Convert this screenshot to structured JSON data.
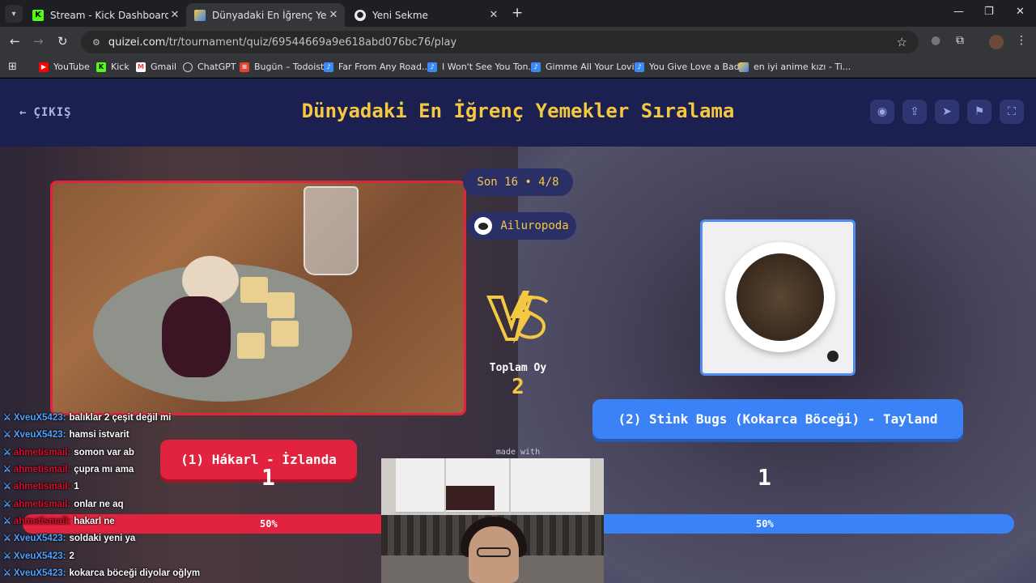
{
  "browser": {
    "tabs": [
      {
        "title": "Stream - Kick Dashboard",
        "favicon": "kick-icon",
        "active": false
      },
      {
        "title": "Dünyadaki En İğrenç Yemekler S",
        "favicon": "quizei-icon",
        "active": true
      },
      {
        "title": "Yeni Sekme",
        "favicon": "chrome-icon",
        "active": false
      }
    ],
    "url_host": "quizei.com",
    "url_path": "/tr/tournament/quiz/69544669a9e618abd076bc76/play",
    "bookmarks": [
      {
        "label": "YouTube",
        "icon": "youtube-icon"
      },
      {
        "label": "Kick",
        "icon": "kick-icon"
      },
      {
        "label": "Gmail",
        "icon": "gmail-icon"
      },
      {
        "label": "ChatGPT",
        "icon": "chatgpt-icon"
      },
      {
        "label": "Bugün – Todoist",
        "icon": "todoist-icon"
      },
      {
        "label": "Far From Any Road...",
        "icon": "music-icon"
      },
      {
        "label": "I Won't See You Ton...",
        "icon": "music-icon"
      },
      {
        "label": "Gimme All Your Lovi...",
        "icon": "music-icon"
      },
      {
        "label": "You Give Love a Bad...",
        "icon": "music-icon"
      },
      {
        "label": "en iyi anime kızı - Ti...",
        "icon": "quizei-icon"
      }
    ]
  },
  "header": {
    "back_label": "ÇIKIŞ",
    "title": "Dünyadaki En İğrenç Yemekler Sıralama",
    "icons": [
      "eye-icon",
      "share-icon",
      "send-icon",
      "flag-icon",
      "fullscreen-icon"
    ]
  },
  "match": {
    "round": "Son 16 • 4/8",
    "author": "Ailuropoda",
    "vote_label": "Toplam Oy",
    "vote_total": "2",
    "made_with": "made with",
    "left": {
      "name": "(1) Hákarl - İzlanda",
      "votes": "1",
      "percent": "50%",
      "share": 0.5
    },
    "right": {
      "name": "(2) Stink Bugs (Kokarca Böceği) - Tayland",
      "votes": "1",
      "percent": "50%",
      "share": 0.5
    }
  },
  "colors": {
    "left": "#e2233f",
    "right": "#3b82f6",
    "accent": "#f5c842"
  },
  "chat": [
    {
      "user": "XveuX5423:",
      "color": "blue",
      "message": "balıklar 2 çeşit değil mi"
    },
    {
      "user": "XveuX5423:",
      "color": "blue",
      "message": "hamsi istvarit"
    },
    {
      "user": "ahmetismail:",
      "color": "red",
      "message": "somon var ab"
    },
    {
      "user": "ahmetismail:",
      "color": "red",
      "message": "çupra mı ama"
    },
    {
      "user": "ahmetismail:",
      "color": "red",
      "message": "1"
    },
    {
      "user": "ahmetismail:",
      "color": "red",
      "message": "onlar ne aq"
    },
    {
      "user": "ahmetismail:",
      "color": "red",
      "message": "hakarl ne"
    },
    {
      "user": "XveuX5423:",
      "color": "blue",
      "message": "soldaki yeni ya"
    },
    {
      "user": "XveuX5423:",
      "color": "blue",
      "message": "2"
    },
    {
      "user": "XveuX5423:",
      "color": "blue",
      "message": "kokarca böceği diyolar oğlym"
    }
  ]
}
